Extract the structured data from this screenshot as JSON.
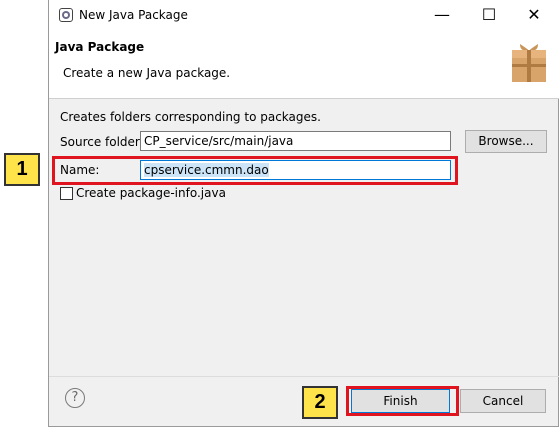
{
  "window": {
    "title": "New Java Package"
  },
  "banner": {
    "title": "Java Package",
    "subtitle": "Create a new Java package."
  },
  "form": {
    "description": "Creates folders corresponding to packages.",
    "source_folder_label": "Source folder:",
    "source_folder_value": "CP_service/src/main/java",
    "browse_label": "Browse...",
    "name_label": "Name:",
    "name_value": "cpservice.cmmn.dao",
    "create_info_label": "Create package-info.java",
    "create_info_checked": false
  },
  "footer": {
    "help_glyph": "?",
    "finish_label": "Finish",
    "cancel_label": "Cancel"
  },
  "callouts": [
    {
      "number": "1"
    },
    {
      "number": "2"
    }
  ],
  "colors": {
    "highlight": "#e0141e",
    "callout_fill": "#ffe34a"
  }
}
